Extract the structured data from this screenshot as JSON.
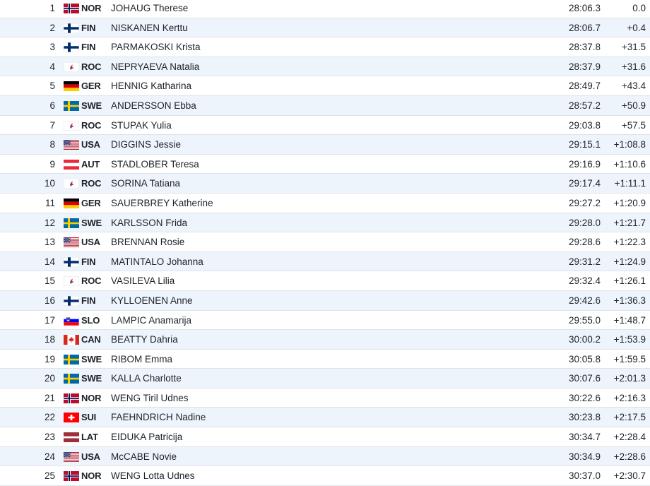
{
  "results": [
    {
      "rank": "1",
      "noc": "NOR",
      "name": "JOHAUG Therese",
      "time": "28:06.3",
      "diff": "0.0",
      "flag_icon": "norway-flag-icon"
    },
    {
      "rank": "2",
      "noc": "FIN",
      "name": "NISKANEN Kerttu",
      "time": "28:06.7",
      "diff": "+0.4",
      "flag_icon": "finland-flag-icon"
    },
    {
      "rank": "3",
      "noc": "FIN",
      "name": "PARMAKOSKI Krista",
      "time": "28:37.8",
      "diff": "+31.5",
      "flag_icon": "finland-flag-icon"
    },
    {
      "rank": "4",
      "noc": "ROC",
      "name": "NEPRYAEVA Natalia",
      "time": "28:37.9",
      "diff": "+31.6",
      "flag_icon": "roc-flag-icon"
    },
    {
      "rank": "5",
      "noc": "GER",
      "name": "HENNIG Katharina",
      "time": "28:49.7",
      "diff": "+43.4",
      "flag_icon": "germany-flag-icon"
    },
    {
      "rank": "6",
      "noc": "SWE",
      "name": "ANDERSSON Ebba",
      "time": "28:57.2",
      "diff": "+50.9",
      "flag_icon": "sweden-flag-icon"
    },
    {
      "rank": "7",
      "noc": "ROC",
      "name": "STUPAK Yulia",
      "time": "29:03.8",
      "diff": "+57.5",
      "flag_icon": "roc-flag-icon"
    },
    {
      "rank": "8",
      "noc": "USA",
      "name": "DIGGINS Jessie",
      "time": "29:15.1",
      "diff": "+1:08.8",
      "flag_icon": "usa-flag-icon"
    },
    {
      "rank": "9",
      "noc": "AUT",
      "name": "STADLOBER Teresa",
      "time": "29:16.9",
      "diff": "+1:10.6",
      "flag_icon": "austria-flag-icon"
    },
    {
      "rank": "10",
      "noc": "ROC",
      "name": "SORINA Tatiana",
      "time": "29:17.4",
      "diff": "+1:11.1",
      "flag_icon": "roc-flag-icon"
    },
    {
      "rank": "11",
      "noc": "GER",
      "name": "SAUERBREY Katherine",
      "time": "29:27.2",
      "diff": "+1:20.9",
      "flag_icon": "germany-flag-icon"
    },
    {
      "rank": "12",
      "noc": "SWE",
      "name": "KARLSSON Frida",
      "time": "29:28.0",
      "diff": "+1:21.7",
      "flag_icon": "sweden-flag-icon"
    },
    {
      "rank": "13",
      "noc": "USA",
      "name": "BRENNAN Rosie",
      "time": "29:28.6",
      "diff": "+1:22.3",
      "flag_icon": "usa-flag-icon"
    },
    {
      "rank": "14",
      "noc": "FIN",
      "name": "MATINTALO Johanna",
      "time": "29:31.2",
      "diff": "+1:24.9",
      "flag_icon": "finland-flag-icon"
    },
    {
      "rank": "15",
      "noc": "ROC",
      "name": "VASILEVA Lilia",
      "time": "29:32.4",
      "diff": "+1:26.1",
      "flag_icon": "roc-flag-icon"
    },
    {
      "rank": "16",
      "noc": "FIN",
      "name": "KYLLOENEN Anne",
      "time": "29:42.6",
      "diff": "+1:36.3",
      "flag_icon": "finland-flag-icon"
    },
    {
      "rank": "17",
      "noc": "SLO",
      "name": "LAMPIC Anamarija",
      "time": "29:55.0",
      "diff": "+1:48.7",
      "flag_icon": "slovenia-flag-icon"
    },
    {
      "rank": "18",
      "noc": "CAN",
      "name": "BEATTY Dahria",
      "time": "30:00.2",
      "diff": "+1:53.9",
      "flag_icon": "canada-flag-icon"
    },
    {
      "rank": "19",
      "noc": "SWE",
      "name": "RIBOM Emma",
      "time": "30:05.8",
      "diff": "+1:59.5",
      "flag_icon": "sweden-flag-icon"
    },
    {
      "rank": "20",
      "noc": "SWE",
      "name": "KALLA Charlotte",
      "time": "30:07.6",
      "diff": "+2:01.3",
      "flag_icon": "sweden-flag-icon"
    },
    {
      "rank": "21",
      "noc": "NOR",
      "name": "WENG Tiril Udnes",
      "time": "30:22.6",
      "diff": "+2:16.3",
      "flag_icon": "norway-flag-icon"
    },
    {
      "rank": "22",
      "noc": "SUI",
      "name": "FAEHNDRICH Nadine",
      "time": "30:23.8",
      "diff": "+2:17.5",
      "flag_icon": "switzerland-flag-icon"
    },
    {
      "rank": "23",
      "noc": "LAT",
      "name": "EIDUKA Patricija",
      "time": "30:34.7",
      "diff": "+2:28.4",
      "flag_icon": "latvia-flag-icon"
    },
    {
      "rank": "24",
      "noc": "USA",
      "name": "McCABE Novie",
      "time": "30:34.9",
      "diff": "+2:28.6",
      "flag_icon": "usa-flag-icon"
    },
    {
      "rank": "25",
      "noc": "NOR",
      "name": "WENG Lotta Udnes",
      "time": "30:37.0",
      "diff": "+2:30.7",
      "flag_icon": "norway-flag-icon"
    }
  ],
  "colors": {
    "row_alt_bg": "#eef4fb",
    "row_border": "#dfe3e8",
    "text": "#1e2228"
  }
}
